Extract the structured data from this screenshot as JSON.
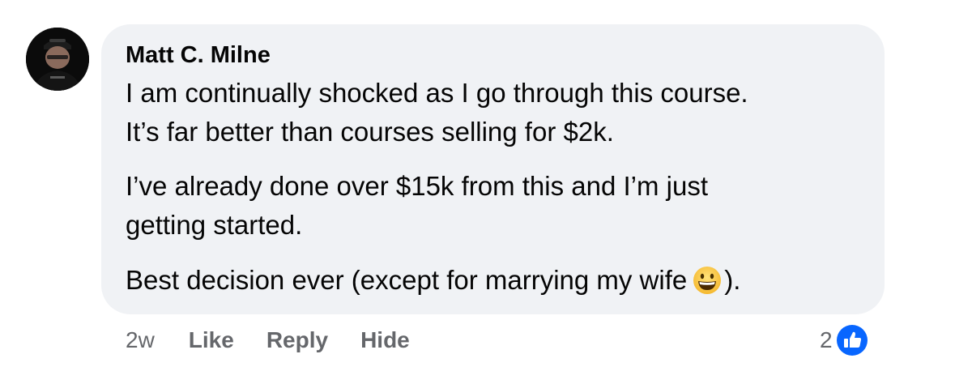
{
  "comment": {
    "author": "Matt C. Milne",
    "paragraphs": [
      {
        "lines": [
          "I am continually shocked as I go through this course.",
          "It’s far better than courses selling for $2k."
        ]
      },
      {
        "lines": [
          "I’ve already done over $15k from this and I’m just",
          "getting started."
        ]
      },
      {
        "before_emoji": "Best decision ever (except for marrying my wife",
        "emoji": "grinning-face-icon",
        "after_emoji": ")."
      }
    ]
  },
  "actions": {
    "timestamp": "2w",
    "like": "Like",
    "reply": "Reply",
    "hide": "Hide"
  },
  "reactions": {
    "count": "2",
    "icon": "thumbs-up-icon"
  },
  "colors": {
    "bubble": "#f0f2f5",
    "text": "#050505",
    "secondary": "#65676b",
    "like_blue": "#0866ff"
  }
}
